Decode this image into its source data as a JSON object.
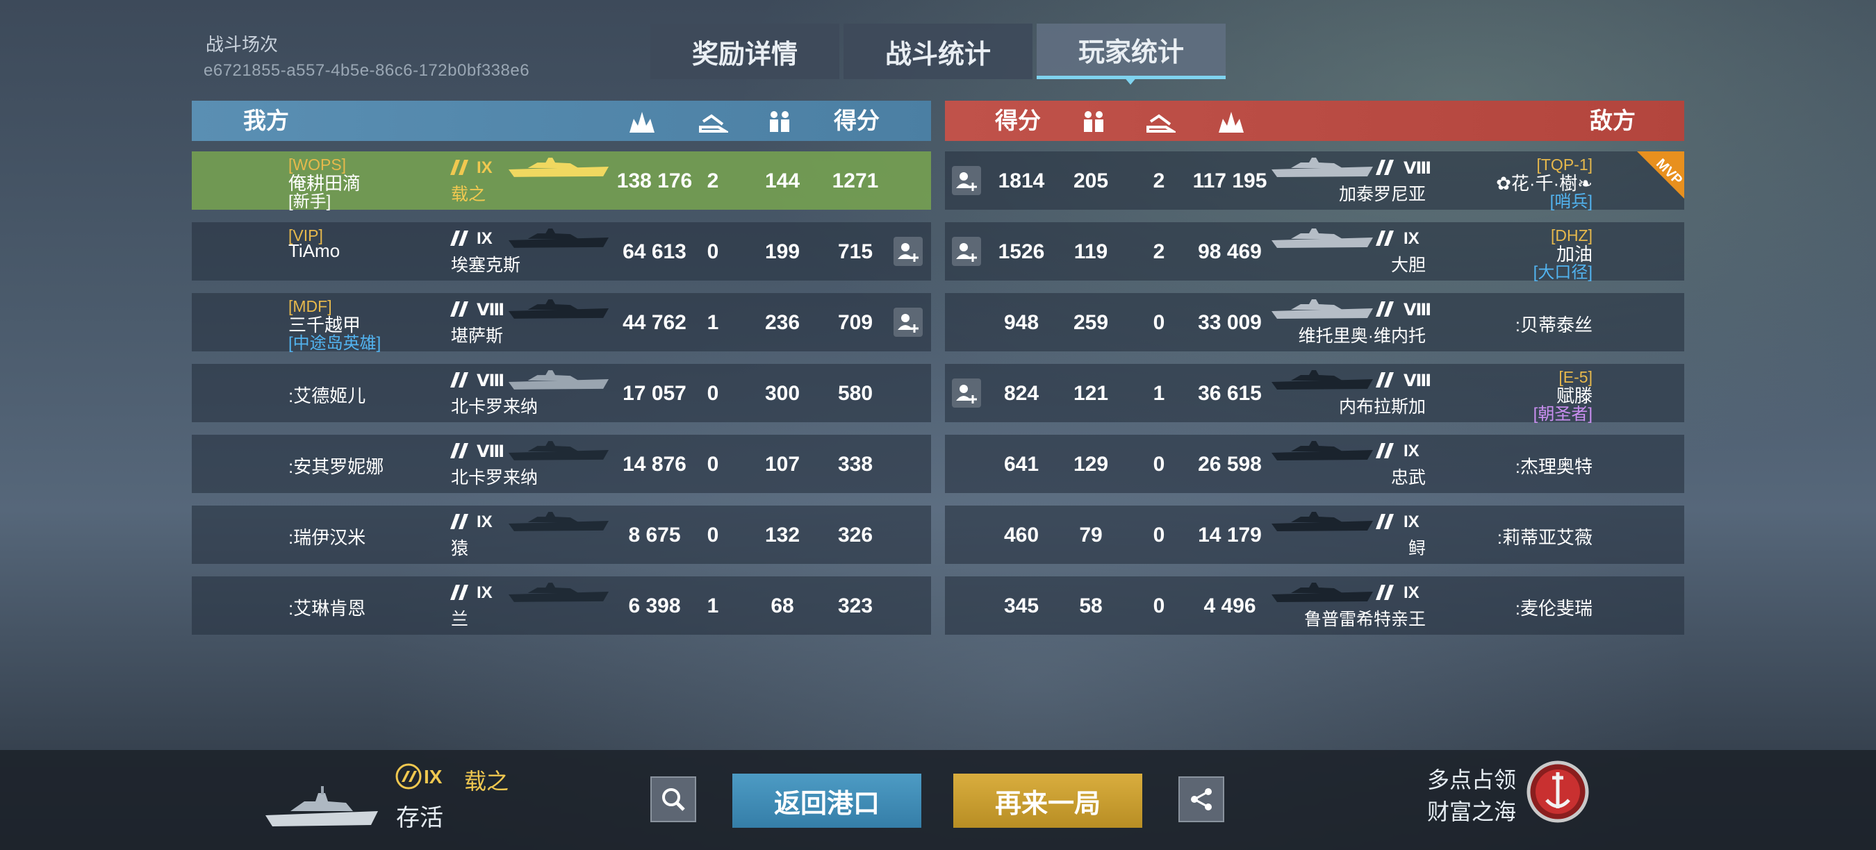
{
  "battle": {
    "label": "战斗场次",
    "id": "e6721855-a557-4b5e-86c6-172b0bf338e6"
  },
  "tabs": [
    {
      "label": "奖励详情"
    },
    {
      "label": "战斗统计"
    },
    {
      "label": "玩家统计"
    }
  ],
  "ours": {
    "title": "我方",
    "score_header": "得分",
    "players": [
      {
        "clan": "[WOPS]",
        "name": "俺耕田滴",
        "title": "[新手]",
        "title_color": "#ffffff",
        "tier": "IX",
        "ship": "载之",
        "damage": "138 176",
        "kills": "2",
        "xp": "144",
        "score": "1271"
      },
      {
        "clan": "[VIP]",
        "name": "TiAmo",
        "title": "",
        "tier": "IX",
        "ship": "埃塞克斯",
        "damage": "64 613",
        "kills": "0",
        "xp": "199",
        "score": "715"
      },
      {
        "clan": "[MDF]",
        "name": "三千越甲",
        "title": "[中途岛英雄]",
        "title_color": "#52b3ef",
        "tier": "Ⅷ",
        "ship": "堪萨斯",
        "damage": "44 762",
        "kills": "1",
        "xp": "236",
        "score": "709"
      },
      {
        "clan": "",
        "name": ":艾德姬儿",
        "title": "",
        "tier": "Ⅷ",
        "ship": "北卡罗来纳",
        "damage": "17 057",
        "kills": "0",
        "xp": "300",
        "score": "580"
      },
      {
        "clan": "",
        "name": ":安其罗妮娜",
        "title": "",
        "tier": "Ⅷ",
        "ship": "北卡罗来纳",
        "damage": "14 876",
        "kills": "0",
        "xp": "107",
        "score": "338"
      },
      {
        "clan": "",
        "name": ":瑞伊汉米",
        "title": "",
        "tier": "IX",
        "ship": "猿",
        "damage": "8 675",
        "kills": "0",
        "xp": "132",
        "score": "326"
      },
      {
        "clan": "",
        "name": ":艾琳肯恩",
        "title": "",
        "tier": "IX",
        "ship": "兰",
        "damage": "6 398",
        "kills": "1",
        "xp": "68",
        "score": "323"
      }
    ]
  },
  "theirs": {
    "title": "敌方",
    "score_header": "得分",
    "players": [
      {
        "clan": "[TQP-1]",
        "name": "✿花·千·樹❧",
        "title": "[哨兵]",
        "title_color": "#52b3ef",
        "tier": "Ⅷ",
        "ship": "加泰罗尼亚",
        "damage": "117 195",
        "kills": "2",
        "xp": "205",
        "score": "1814"
      },
      {
        "clan": "[DHZ]",
        "name": "加油",
        "title": "[大口径]",
        "title_color": "#52b3ef",
        "tier": "IX",
        "ship": "大胆",
        "damage": "98 469",
        "kills": "2",
        "xp": "119",
        "score": "1526"
      },
      {
        "clan": "",
        "name": ":贝蒂泰丝",
        "title": "",
        "tier": "Ⅷ",
        "ship": "维托里奥·维内托",
        "damage": "33 009",
        "kills": "0",
        "xp": "259",
        "score": "948"
      },
      {
        "clan": "[E-5]",
        "name": "赋滕",
        "title": "[朝圣者]",
        "title_color": "#c98ef0",
        "tier": "Ⅷ",
        "ship": "内布拉斯加",
        "damage": "36 615",
        "kills": "1",
        "xp": "121",
        "score": "824"
      },
      {
        "clan": "",
        "name": ":杰理奥特",
        "title": "",
        "tier": "IX",
        "ship": "忠武",
        "damage": "26 598",
        "kills": "0",
        "xp": "129",
        "score": "641"
      },
      {
        "clan": "",
        "name": ":莉蒂亚艾薇",
        "title": "",
        "tier": "IX",
        "ship": "鲟",
        "damage": "14 179",
        "kills": "0",
        "xp": "79",
        "score": "460"
      },
      {
        "clan": "",
        "name": ":麦伦斐瑞",
        "title": "",
        "tier": "IX",
        "ship": "鲁普雷希特亲王",
        "damage": "4 496",
        "kills": "0",
        "xp": "58",
        "score": "345"
      }
    ]
  },
  "mvp_label": "MVP",
  "bottom": {
    "tier": "IX",
    "ship": "载之",
    "status": "存活",
    "return_label": "返回港口",
    "again_label": "再来一局",
    "mode_line1": "多点占领",
    "mode_line2": "财富之海"
  },
  "colors": {
    "ours": "#4f85aa",
    "theirs": "#b84a42",
    "highlight": "#7aa552",
    "gold": "#f0c850",
    "accent": "#7fd3ef"
  }
}
